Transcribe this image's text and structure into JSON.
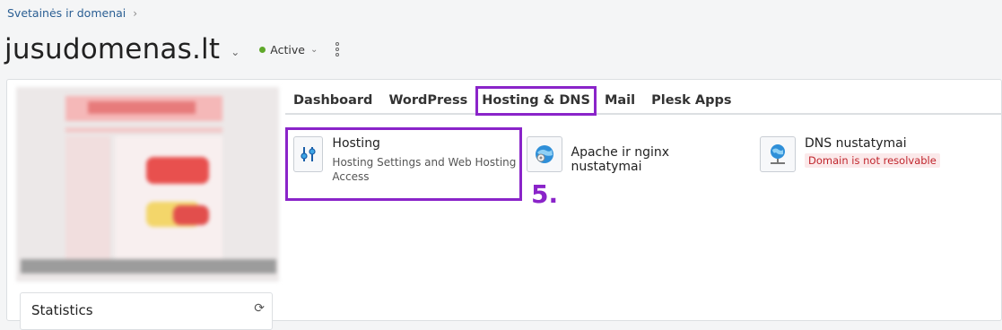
{
  "breadcrumb": {
    "label": "Svetainės ir domenai"
  },
  "header": {
    "domain": "jusudomenas.lt",
    "status": "Active"
  },
  "tabs": [
    {
      "label": "Dashboard"
    },
    {
      "label": "WordPress"
    },
    {
      "label": "Hosting & DNS"
    },
    {
      "label": "Mail"
    },
    {
      "label": "Plesk Apps"
    }
  ],
  "cards": {
    "hosting": {
      "title": "Hosting",
      "desc": "Hosting Settings and Web Hosting Access"
    },
    "apache": {
      "title": "Apache ir nginx nustatymai"
    },
    "dns": {
      "title": "DNS nustatymai",
      "badge": "Domain is not resolvable"
    }
  },
  "annotation": {
    "step": "5."
  },
  "sidebar": {
    "stats_label": "Statistics"
  },
  "colors": {
    "accent": "#8a24c9",
    "active_dot": "#5fa82a",
    "error": "#c0262d"
  }
}
